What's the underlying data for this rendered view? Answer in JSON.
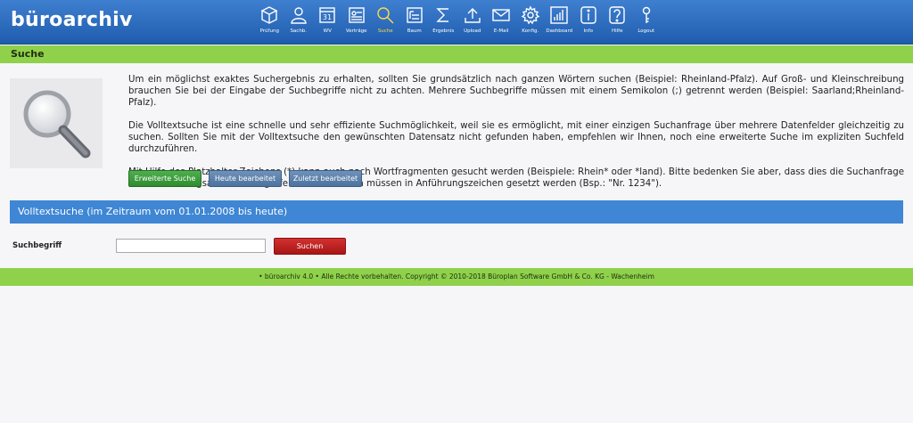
{
  "app": {
    "logo": "büroarchiv"
  },
  "nav": [
    {
      "label": "Prüfung",
      "icon": "boxes-icon"
    },
    {
      "label": "Sachb.",
      "icon": "user-icon"
    },
    {
      "label": "WV",
      "icon": "calendar-icon",
      "badge": "31"
    },
    {
      "label": "Verträge",
      "icon": "contract-icon"
    },
    {
      "label": "Suche",
      "icon": "magnifier-icon",
      "active": true
    },
    {
      "label": "Baum",
      "icon": "tree-icon"
    },
    {
      "label": "Ergebnis",
      "icon": "sigma-icon"
    },
    {
      "label": "Upload",
      "icon": "upload-icon"
    },
    {
      "label": "E-Mail",
      "icon": "mail-icon"
    },
    {
      "label": "Konfig.",
      "icon": "gear-icon"
    },
    {
      "label": "Dashboard",
      "icon": "bar-chart-icon"
    },
    {
      "label": "Info",
      "icon": "info-icon"
    },
    {
      "label": "Hilfe",
      "icon": "help-icon"
    },
    {
      "label": "Logout",
      "icon": "key-icon"
    }
  ],
  "page": {
    "title": "Suche"
  },
  "intro": {
    "p1": "Um ein möglichst exaktes Suchergebnis zu erhalten, sollten Sie grundsätzlich nach ganzen Wörtern suchen (Beispiel: Rheinland-Pfalz). Auf Groß- und Kleinschreibung brauchen Sie bei der Eingabe der Suchbegriffe nicht zu achten. Mehrere Suchbegriffe müssen mit einem Semikolon (;) getrennt werden (Beispiel: Saarland;Rheinland-Pfalz).",
    "p2": "Die Volltextsuche ist eine schnelle und sehr effiziente Suchmöglichkeit, weil sie es ermöglicht, mit einer einzigen Suchanfrage über mehrere Datenfelder gleichzeitig zu suchen. Sollten Sie mit der Volltextsuche den gewünschten Datensatz nicht gefunden haben, empfehlen wir Ihnen, noch eine erweiterte Suche im expliziten Suchfeld durchzuführen.",
    "p3": "Mit Hilfe des Platzhalter-Zeichens (*) kann auch nach Wortfragmenten gesucht werden (Beispiele: Rhein* oder *land). Bitte bedenken Sie aber, dass dies die Suchanfrage deutlich verlangsamt. Suchbegriffe mit Leerzeichen müssen in Anführungszeichen gesetzt werden (Bsp.: \"Nr. 1234\")."
  },
  "buttons": {
    "advanced": "Erweiterte Suche",
    "today": "Heute bearbeitet",
    "recent": "Zuletzt bearbeitet",
    "search": "Suchen"
  },
  "section": {
    "title": "Volltextsuche (im Zeitraum vom 01.01.2008 bis heute)"
  },
  "form": {
    "label": "Suchbegriff",
    "value": "",
    "placeholder": ""
  },
  "footer": {
    "text": "• büroarchiv 4.0 •     Alle Rechte vorbehalten. Copyright © 2010-2018 Büroplan Software GmbH & Co. KG - Wachenheim"
  }
}
